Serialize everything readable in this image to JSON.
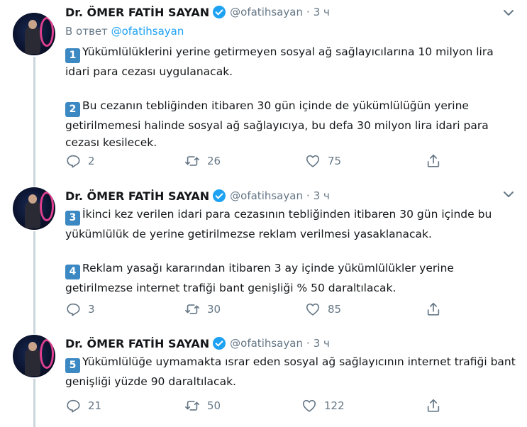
{
  "tweets": [
    {
      "name": "Dr. ÖMER FATİH SAYAN",
      "handle": "@ofatihsayan",
      "separator": "·",
      "time": "3 ч",
      "reply_prefix": "В ответ",
      "reply_mention": "@ofatihsayan",
      "paragraphs": [
        {
          "keycap": "1",
          "text": "Yükümlülüklerini yerine getirmeyen sosyal ağ sağlayıcılarına 10 milyon lira idari para cezası uygulanacak."
        },
        {
          "keycap": "2",
          "text": "Bu cezanın tebliğinden itibaren 30 gün içinde de yükümlülüğün yerine getirilmemesi halinde sosyal ağ sağlayıcıya, bu defa 30 milyon lira idari para cezası kesilecek."
        }
      ],
      "stats": {
        "replies": "2",
        "retweets": "26",
        "likes": "75"
      }
    },
    {
      "name": "Dr. ÖMER FATİH SAYAN",
      "handle": "@ofatihsayan",
      "separator": "·",
      "time": "3 ч",
      "paragraphs": [
        {
          "keycap": "3",
          "text": "İkinci kez verilen idari para cezasının tebliğinden itibaren 30 gün içinde bu yükümlülük de yerine getirilmezse reklam verilmesi yasaklanacak."
        },
        {
          "keycap": "4",
          "text": "Reklam yasağı kararından itibaren 3 ay içinde yükümlülükler yerine getirilmezse internet trafiği bant genişliği % 50 daraltılacak."
        }
      ],
      "stats": {
        "replies": "3",
        "retweets": "30",
        "likes": "85"
      }
    },
    {
      "name": "Dr. ÖMER FATİH SAYAN",
      "handle": "@ofatihsayan",
      "separator": "·",
      "time": "3 ч",
      "paragraphs": [
        {
          "keycap": "5",
          "text": "Yükümlülüğe uymamakta ısrar eden sosyal ağ sağlayıcının internet trafiği bant genişliği yüzde 90 daraltılacak."
        }
      ],
      "stats": {
        "replies": "21",
        "retweets": "50",
        "likes": "122"
      }
    }
  ],
  "icons": {
    "verified": "verified-badge-icon",
    "caret": "chevron-down-icon",
    "reply": "reply-icon",
    "retweet": "retweet-icon",
    "like": "heart-icon",
    "share": "share-icon"
  },
  "colors": {
    "accent": "#1da1f2",
    "muted": "#657786",
    "text": "#14171a",
    "keycap": "#3b88c3",
    "thread_line": "#ccd6dd"
  }
}
